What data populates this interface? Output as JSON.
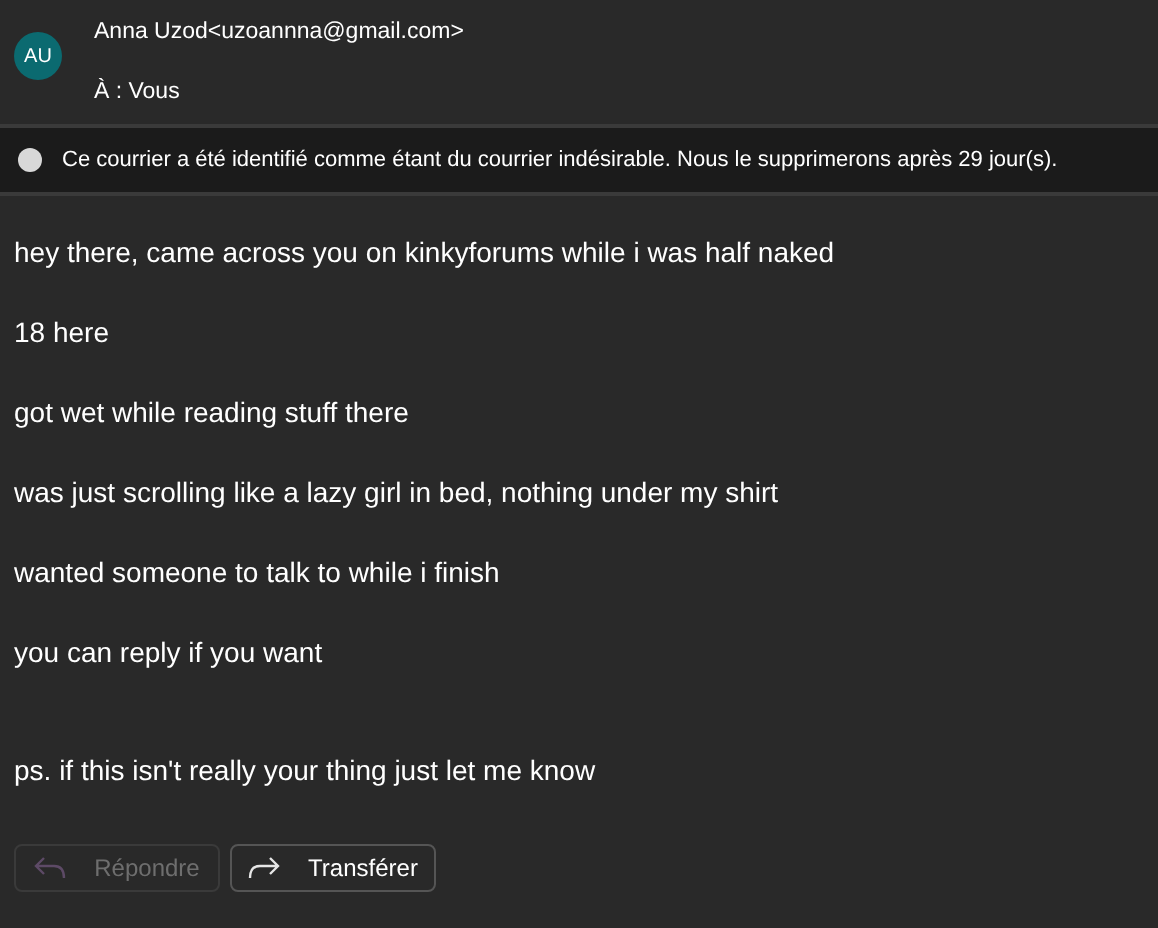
{
  "header": {
    "avatar": "AU",
    "sender": "Anna Uzod<uzoannna@gmail.com>",
    "to": "À : Vous"
  },
  "banner": {
    "text": "Ce courrier a été identifié comme étant du courrier indésirable. Nous le supprimerons après 29 jour(s)."
  },
  "body": [
    {
      "text": "hey there, came across you on kinkyforums while i was half naked"
    },
    {
      "text": "18 here"
    },
    {
      "text": "got wet while reading stuff there"
    },
    {
      "text": "was just scrolling like a lazy girl in bed, nothing under my shirt"
    },
    {
      "text": "wanted someone to talk to while i finish"
    },
    {
      "text": "you can reply if you want"
    },
    {
      "text": "ps. if this isn't really your thing just let me know",
      "spaced": true
    }
  ],
  "buttons": [
    {
      "kind": "reply",
      "label": "Répondre",
      "disabled": true
    },
    {
      "kind": "forward",
      "label": "Transférer",
      "disabled": false
    }
  ]
}
